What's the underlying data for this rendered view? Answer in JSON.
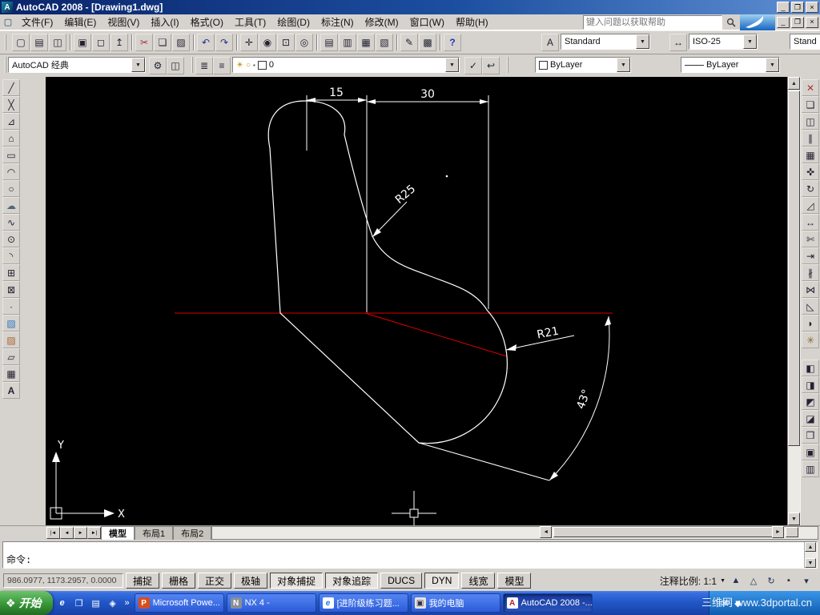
{
  "window": {
    "title": "AutoCAD 2008 - [Drawing1.dwg]"
  },
  "menu": {
    "items": [
      "文件(F)",
      "编辑(E)",
      "视图(V)",
      "插入(I)",
      "格式(O)",
      "工具(T)",
      "绘图(D)",
      "标注(N)",
      "修改(M)",
      "窗口(W)",
      "帮助(H)"
    ],
    "search_placeholder": "键入问题以获取帮助"
  },
  "toolbar": {
    "text_style_current": "Standard",
    "dim_style_current": "ISO-25",
    "text_style_partial": "Stand",
    "workspace_current": "AutoCAD 经典",
    "layer_current": "0",
    "color_current": "ByLayer",
    "linetype_current": "ByLayer"
  },
  "colors": {
    "outline": "#ffffff",
    "construction": "#d80000",
    "canvas_bg": "#000000"
  },
  "canvas": {
    "dims": {
      "d15": "15",
      "d30": "30",
      "r25": "R25",
      "r21": "R21",
      "angle": "43°"
    },
    "ucs": {
      "x": "X",
      "y": "Y"
    }
  },
  "layout_tabs": {
    "model": "模型",
    "layout1": "布局1",
    "layout2": "布局2"
  },
  "command": {
    "prompt": "命令:"
  },
  "statusbar": {
    "coords": "986.0977, 1173.2957, 0.0000",
    "toggles": [
      "捕捉",
      "栅格",
      "正交",
      "极轴",
      "对象捕捉",
      "对象追踪",
      "DUCS",
      "DYN",
      "线宽",
      "模型"
    ],
    "annotation_scale": "注释比例: 1:1"
  },
  "taskbar": {
    "start": "开始",
    "tasks": [
      {
        "label": "Microsoft Powe..."
      },
      {
        "label": "NX 4 -"
      },
      {
        "label": "[进阶级练习题..."
      },
      {
        "label": "我的电脑"
      },
      {
        "label": "AutoCAD 2008 -..."
      }
    ],
    "watermark": "三维网 www.3dportal.cn"
  },
  "glyphs": {
    "acad": "A",
    "doc": "▢",
    "min": "_",
    "restore": "❐",
    "close": "×",
    "new": "▢",
    "open": "▤",
    "save": "◫",
    "plot": "▣",
    "preview": "◻",
    "publish": "↥",
    "cut": "✂",
    "copy": "❏",
    "paste": "▨",
    "undo": "↶",
    "redo": "↷",
    "pan": "✛",
    "zoomrt": "◉",
    "zoomwin": "⊡",
    "zoomprev": "◎",
    "props": "▤",
    "dcenter": "▥",
    "palettes": "▦",
    "sheetset": "▧",
    "markup": "✎",
    "calc": "▩",
    "help": "?",
    "styles": "A",
    "dimstyle": "↔",
    "gear": "⚙",
    "wsave": "◫",
    "layers": "≣",
    "lstates": "≡",
    "sun": "☀",
    "bulb": "○",
    "lock": "▪",
    "mkcur": "✓",
    "lprev": "↩",
    "dropdown": "▼",
    "line": "╱",
    "xline": "╳",
    "pline": "⊿",
    "polygon": "⌂",
    "rect": "▭",
    "arc": "◠",
    "circle": "○",
    "revcloud": "☁",
    "spline": "∿",
    "ellipse": "⊙",
    "earc": "◝",
    "insblock": "⊞",
    "mkblock": "⊠",
    "point": "∙",
    "hatch": "▧",
    "gradient": "▨",
    "region": "▱",
    "table": "▦",
    "mtext": "A",
    "erase": "✕",
    "mcopy": "❏",
    "mirror": "◫",
    "offset": "∥",
    "array": "▦",
    "move": "✜",
    "rotate": "↻",
    "scale": "◿",
    "stretch": "↔",
    "trim": "✄",
    "extend": "⇥",
    "brk": "∦",
    "join": "⋈",
    "chamfer": "◺",
    "fillet": "◗",
    "explode": "✳",
    "o1": "◧",
    "o2": "◨",
    "o3": "◩",
    "o4": "◪",
    "o5": "❒",
    "o6": "▣",
    "o7": "▥",
    "navfirst": "|◄",
    "navprev": "◄",
    "navnext": "►",
    "navlast": "►|",
    "up": "▲",
    "down": "▼",
    "left": "◄",
    "right": "►",
    "ann1": "▲",
    "ann2": "△",
    "ann3": "↻",
    "lockpad": "▪",
    "chev": "▾",
    "startflag": "❖",
    "ql1": "e",
    "ql2": "❐",
    "ql3": "▤",
    "ql4": "◈",
    "qlchev": "»",
    "t_ppt": "P",
    "t_nx": "N",
    "t_ie": "e",
    "t_pc": "▣",
    "t_acad": "A",
    "tray1": "✉",
    "tray2": "◆"
  }
}
